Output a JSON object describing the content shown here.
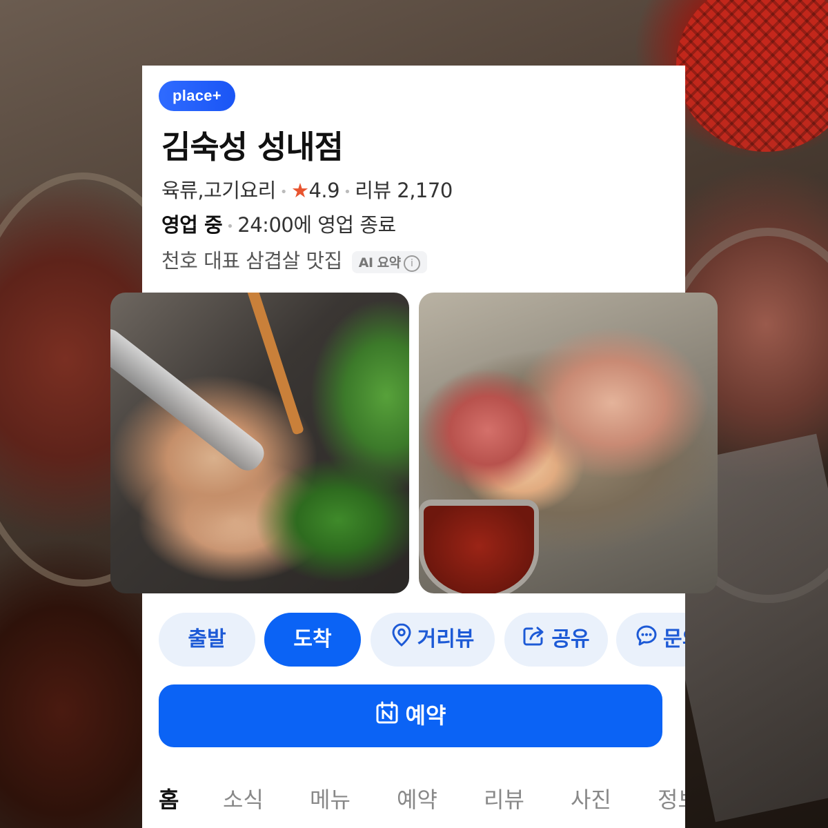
{
  "badge": "place+",
  "place": {
    "name": "김숙성 성내점",
    "category": "육류,고기요리",
    "rating_star": "★",
    "rating": "4.9",
    "reviews": "리뷰 2,170",
    "status": "영업 중",
    "hours": "24:00에 영업 종료",
    "summary": "천호 대표 삼겹살 맛집",
    "ai_tag": "AI 요약",
    "ai_info": "i"
  },
  "photos": [
    {
      "icon": "grilled-pork-photo"
    },
    {
      "icon": "raw-meat-platter-photo"
    }
  ],
  "actions": {
    "depart": "출발",
    "arrive": "도착",
    "street_view": "거리뷰",
    "share": "공유",
    "ask": "문의"
  },
  "reserve": "예약",
  "tabs": [
    "홈",
    "소식",
    "메뉴",
    "예약",
    "리뷰",
    "사진",
    "정보"
  ],
  "colors": {
    "accent": "#0b63f5",
    "star": "#e8542f",
    "pill_bg": "#eaf1fb"
  }
}
